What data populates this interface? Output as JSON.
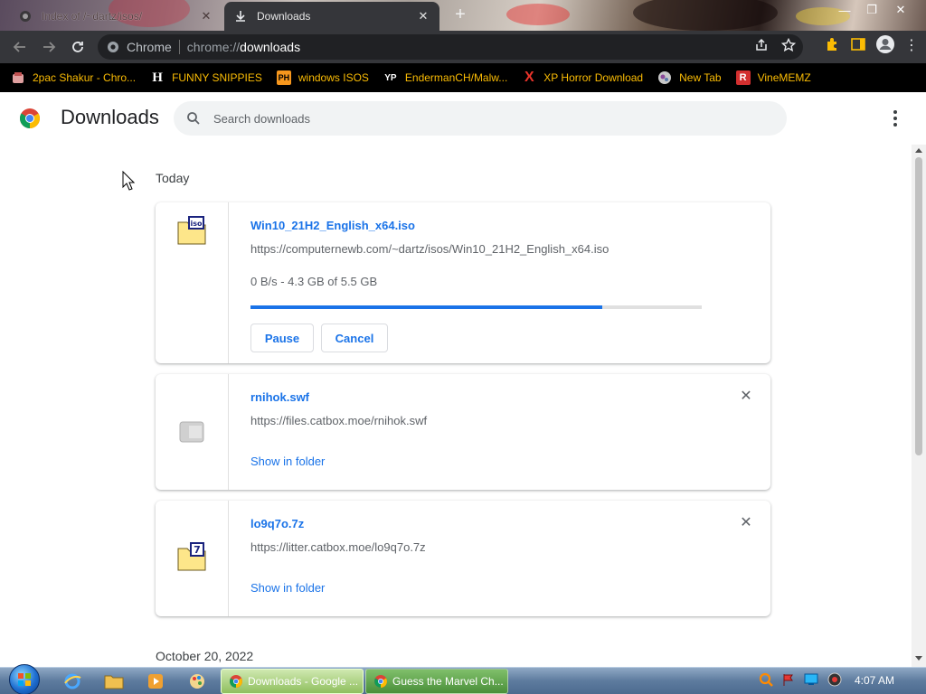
{
  "tabs": [
    {
      "title": "Index of /~dartz/isos/",
      "active": false
    },
    {
      "title": "Downloads",
      "active": true
    }
  ],
  "toolbar": {
    "omnibox_chip": "Chrome",
    "url_prefix": "chrome://",
    "url_host": "downloads"
  },
  "bookmarks": [
    {
      "label": "2pac Shakur - Chro...",
      "icon": "bookmark-favicon"
    },
    {
      "label": "FUNNY SNIPPIES",
      "icon": "H"
    },
    {
      "label": "windows ISOS",
      "icon": "PH"
    },
    {
      "label": "EndermanCH/Malw...",
      "icon": "YP"
    },
    {
      "label": "XP Horror Download",
      "icon": "X"
    },
    {
      "label": "New Tab",
      "icon": "globe-icon"
    },
    {
      "label": "VineMEMZ",
      "icon": "R"
    }
  ],
  "downloads_page": {
    "title": "Downloads",
    "search_placeholder": "Search downloads",
    "sections": [
      {
        "date": "Today",
        "items": [
          {
            "name": "Win10_21H2_English_x64.iso",
            "url": "https://computernewb.com/~dartz/isos/Win10_21H2_English_x64.iso",
            "status": "0 B/s - 4.3 GB of 5.5 GB",
            "progress": 0.78,
            "buttons": [
              "Pause",
              "Cancel"
            ],
            "icon": "iso-file-icon"
          },
          {
            "name": "rnihok.swf",
            "url": "https://files.catbox.moe/rnihok.swf",
            "link": "Show in folder",
            "icon": "generic-file-icon"
          },
          {
            "name": "lo9q7o.7z",
            "url": "https://litter.catbox.moe/lo9q7o.7z",
            "link": "Show in folder",
            "icon": "7z-archive-icon"
          }
        ]
      },
      {
        "date": "October 20, 2022",
        "items": []
      }
    ]
  },
  "taskbar": {
    "buttons": [
      {
        "label": "Downloads - Google ...",
        "active": true
      },
      {
        "label": "Guess the Marvel Ch...",
        "active": false
      }
    ],
    "clock": "4:07 AM"
  },
  "colors": {
    "accent": "#1a73e8",
    "toolbar_bg": "#35363a",
    "bookmark_text": "#fbbc04"
  }
}
